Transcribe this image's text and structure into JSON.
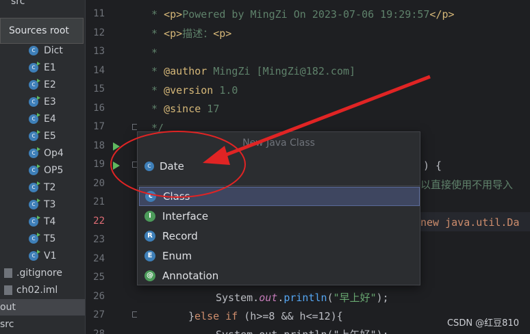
{
  "sidebar": {
    "top_partial": "src",
    "tooltip": "Sources root",
    "classes": [
      "Dict",
      "E1",
      "E2",
      "E3",
      "E4",
      "E5",
      "Op4",
      "OP5",
      "T2",
      "T3",
      "T4",
      "T5",
      "V1"
    ],
    "files": [
      ".gitignore",
      "ch02.iml"
    ],
    "bottom_items": [
      "out",
      "src"
    ]
  },
  "gutter": {
    "line_numbers": [
      "11",
      "12",
      "13",
      "14",
      "15",
      "16",
      "17",
      "18",
      "19",
      "20",
      "21",
      "22",
      "23",
      "24",
      "25",
      "26",
      "27",
      "28"
    ],
    "current_line": "22"
  },
  "code": {
    "l11_a": " * ",
    "l11_tag1": "<p>",
    "l11_b": "Powered by MingZi On 2023-07-06 19:29:57",
    "l11_tag2": "</p>",
    "l12_a": " * ",
    "l12_tag1": "<p>",
    "l12_b": "描述：",
    "l12_tag2": "<p>",
    "l13": " *",
    "l14_a": " * ",
    "l14_tag": "@author",
    "l14_b": " MingZi [MingZi@182.com]",
    "l15_a": " * ",
    "l15_tag": "@version",
    "l15_b": " 1.0",
    "l16_a": " * ",
    "l16_tag": "@since",
    "l16_b": " 17",
    "l17": " */",
    "l19_tail": ") {",
    "l20_tail": "以直接使用不用导入",
    "l22_tail": "new java.util.Da",
    "l26_a": "System.",
    "l26_out": "out",
    "l26_b": ".",
    "l26_m": "println",
    "l26_c": "(",
    "l26_str": "\"早上好\"",
    "l26_d": ");",
    "l27_a": "}",
    "l27_kw1": "else",
    "l27_b": " ",
    "l27_kw2": "if",
    "l27_c": " (h>=8 && h<=12){",
    "l28_partial": "System.out.println(\"上午好\");"
  },
  "popup": {
    "title": "New Java Class",
    "input_value": "Date",
    "options": [
      "Class",
      "Interface",
      "Record",
      "Enum",
      "Annotation"
    ],
    "selected": "Class"
  },
  "watermark": "CSDN @红豆810",
  "colors": {
    "annotation_red": "#e02424",
    "selection": "#3e4660"
  }
}
